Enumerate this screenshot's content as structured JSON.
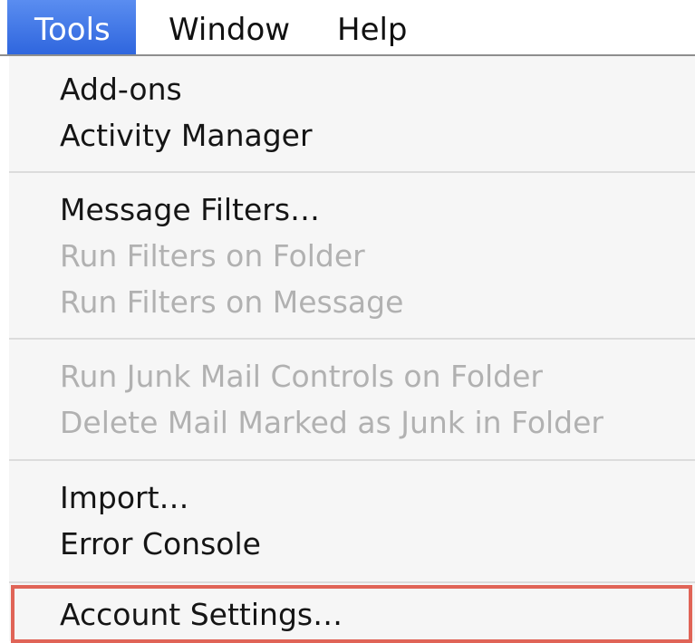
{
  "menubar": {
    "items": [
      {
        "label": "Tools",
        "active": true
      },
      {
        "label": "Window",
        "active": false
      },
      {
        "label": "Help",
        "active": false
      }
    ]
  },
  "menu": {
    "items": [
      {
        "label": "Add-ons",
        "enabled": true
      },
      {
        "label": "Activity Manager",
        "enabled": true
      },
      {
        "label": "Message Filters…",
        "enabled": true
      },
      {
        "label": "Run Filters on Folder",
        "enabled": false
      },
      {
        "label": "Run Filters on Message",
        "enabled": false
      },
      {
        "label": "Run Junk Mail Controls on Folder",
        "enabled": false
      },
      {
        "label": "Delete Mail Marked as Junk in Folder",
        "enabled": false
      },
      {
        "label": "Import…",
        "enabled": true
      },
      {
        "label": "Error Console",
        "enabled": true
      },
      {
        "label": "Account Settings…",
        "enabled": true,
        "highlighted": true
      }
    ]
  },
  "colors": {
    "active_menu": "#2f66de",
    "highlight_border": "#e06457",
    "disabled_text": "#b1b1b1"
  }
}
